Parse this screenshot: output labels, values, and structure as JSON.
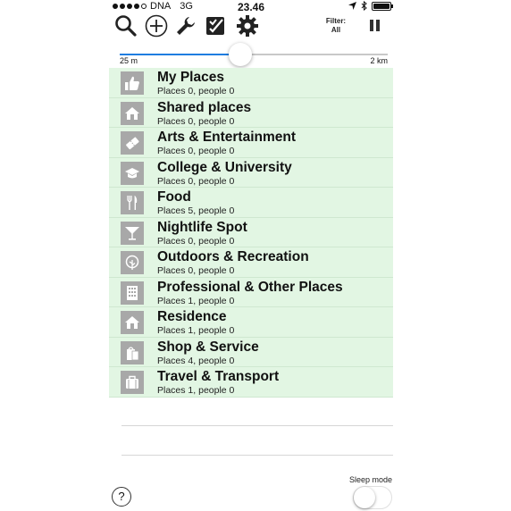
{
  "status_bar": {
    "carrier": "DNA",
    "network": "3G",
    "time": "23.46",
    "signal_dots_filled": 4,
    "signal_dots_total": 5,
    "battery_level": 1.0
  },
  "toolbar": {
    "icons": [
      "search-icon",
      "add-circle-icon",
      "wrench-icon",
      "checklist-icon",
      "gear-icon",
      "pause-icon"
    ],
    "filter_label": "Filter:",
    "filter_value": "All"
  },
  "radius_slider": {
    "min_label": "25 m",
    "max_label": "2 km",
    "value_fraction": 0.45,
    "accent_color": "#1f7de0"
  },
  "categories": [
    {
      "title": "My Places",
      "subtitle": "Places 0, people 0",
      "icon": "thumbs-up-icon"
    },
    {
      "title": "Shared places",
      "subtitle": "Places 0, people 0",
      "icon": "house-icon"
    },
    {
      "title": "Arts & Entertainment",
      "subtitle": "Places 0, people 0",
      "icon": "ticket-icon"
    },
    {
      "title": "College & University",
      "subtitle": "Places 0, people 0",
      "icon": "graduation-cap-icon"
    },
    {
      "title": "Food",
      "subtitle": "Places 5, people 0",
      "icon": "fork-knife-icon"
    },
    {
      "title": "Nightlife Spot",
      "subtitle": "Places 0, people 0",
      "icon": "cocktail-icon"
    },
    {
      "title": "Outdoors & Recreation",
      "subtitle": "Places 0, people 0",
      "icon": "tree-icon"
    },
    {
      "title": "Professional & Other Places",
      "subtitle": "Places 1, people 0",
      "icon": "office-building-icon"
    },
    {
      "title": "Residence",
      "subtitle": "Places 1, people 0",
      "icon": "house-icon"
    },
    {
      "title": "Shop & Service",
      "subtitle": "Places 4, people 0",
      "icon": "shopping-bag-icon"
    },
    {
      "title": "Travel & Transport",
      "subtitle": "Places 1, people 0",
      "icon": "suitcase-icon"
    }
  ],
  "list_colors": {
    "row_background": "#e2f6e3",
    "icon_background": "#a8a8a8"
  },
  "footer": {
    "help_label": "?",
    "sleep_mode_label": "Sleep mode",
    "sleep_mode_on": false
  }
}
